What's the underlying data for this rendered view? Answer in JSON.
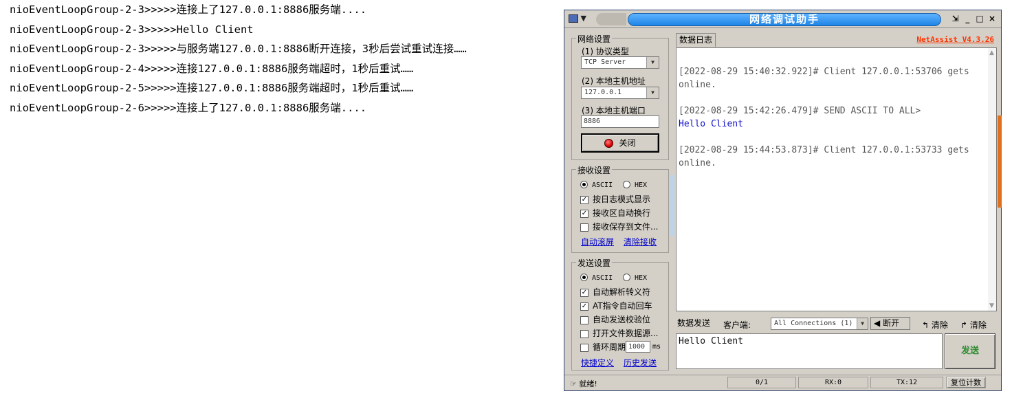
{
  "console": {
    "lines": [
      "nioEventLoopGroup-2-3>>>>>连接上了127.0.0.1:8886服务端....",
      "nioEventLoopGroup-2-3>>>>>Hello Client",
      "nioEventLoopGroup-2-3>>>>>与服务端127.0.0.1:8886断开连接，3秒后尝试重试连接……",
      "nioEventLoopGroup-2-4>>>>>连接127.0.0.1:8886服务端超时，1秒后重试……",
      "nioEventLoopGroup-2-5>>>>>连接127.0.0.1:8886服务端超时，1秒后重试……",
      "nioEventLoopGroup-2-6>>>>>连接上了127.0.0.1:8886服务端...."
    ]
  },
  "window": {
    "title": "网络调试助手",
    "controls": [
      "▼",
      "_",
      "□",
      "×"
    ]
  },
  "net_settings": {
    "legend": "网络设置",
    "protocol_label": "(1) 协议类型",
    "protocol_value": "TCP Server",
    "host_label": "(2) 本地主机地址",
    "host_value": "127.0.0.1",
    "port_label": "(3) 本地主机端口",
    "port_value": "8886",
    "close_button": "关闭"
  },
  "recv_settings": {
    "legend": "接收设置",
    "ascii": "ASCII",
    "hex": "HEX",
    "opt_log_mode": "按日志模式显示",
    "opt_auto_wrap": "接收区自动换行",
    "opt_save_file": "接收保存到文件...",
    "link_auto_scroll": "自动滚屏",
    "link_clear_recv": "清除接收"
  },
  "send_settings": {
    "legend": "发送设置",
    "ascii": "ASCII",
    "hex": "HEX",
    "opt_parse_escape": "自动解析转义符",
    "opt_at_cr": "AT指令自动回车",
    "opt_checksum": "自动发送校验位",
    "opt_file_source": "打开文件数据源...",
    "opt_loop": "循环周期",
    "loop_value": "1000",
    "loop_unit": "ms",
    "link_shortcut": "快捷定义",
    "link_history": "历史发送"
  },
  "log": {
    "tab": "数据日志",
    "version": "NetAssist V4.3.26",
    "lines": [
      {
        "text": "[2022-08-29 15:40:32.922]# Client 127.0.0.1:53706 gets",
        "blue": false
      },
      {
        "text": "online.",
        "blue": false
      },
      {
        "text": "[2022-08-29 15:42:26.479]# SEND ASCII TO ALL>",
        "blue": false
      },
      {
        "text": "Hello Client",
        "blue": true
      },
      {
        "text": "[2022-08-29 15:44:53.873]# Client 127.0.0.1:53733 gets",
        "blue": false
      },
      {
        "text": "online.",
        "blue": false
      }
    ]
  },
  "send": {
    "tab": "数据发送",
    "client_label": "客户端:",
    "client_value": "All Connections (1)",
    "disconnect": "断开",
    "clear1": "清除",
    "clear2": "清除",
    "text": "Hello Client",
    "send_button": "发送"
  },
  "status": {
    "ready": "就绪!",
    "count": "0/1",
    "rx": "RX:0",
    "tx": "TX:12",
    "reset": "复位计数"
  }
}
